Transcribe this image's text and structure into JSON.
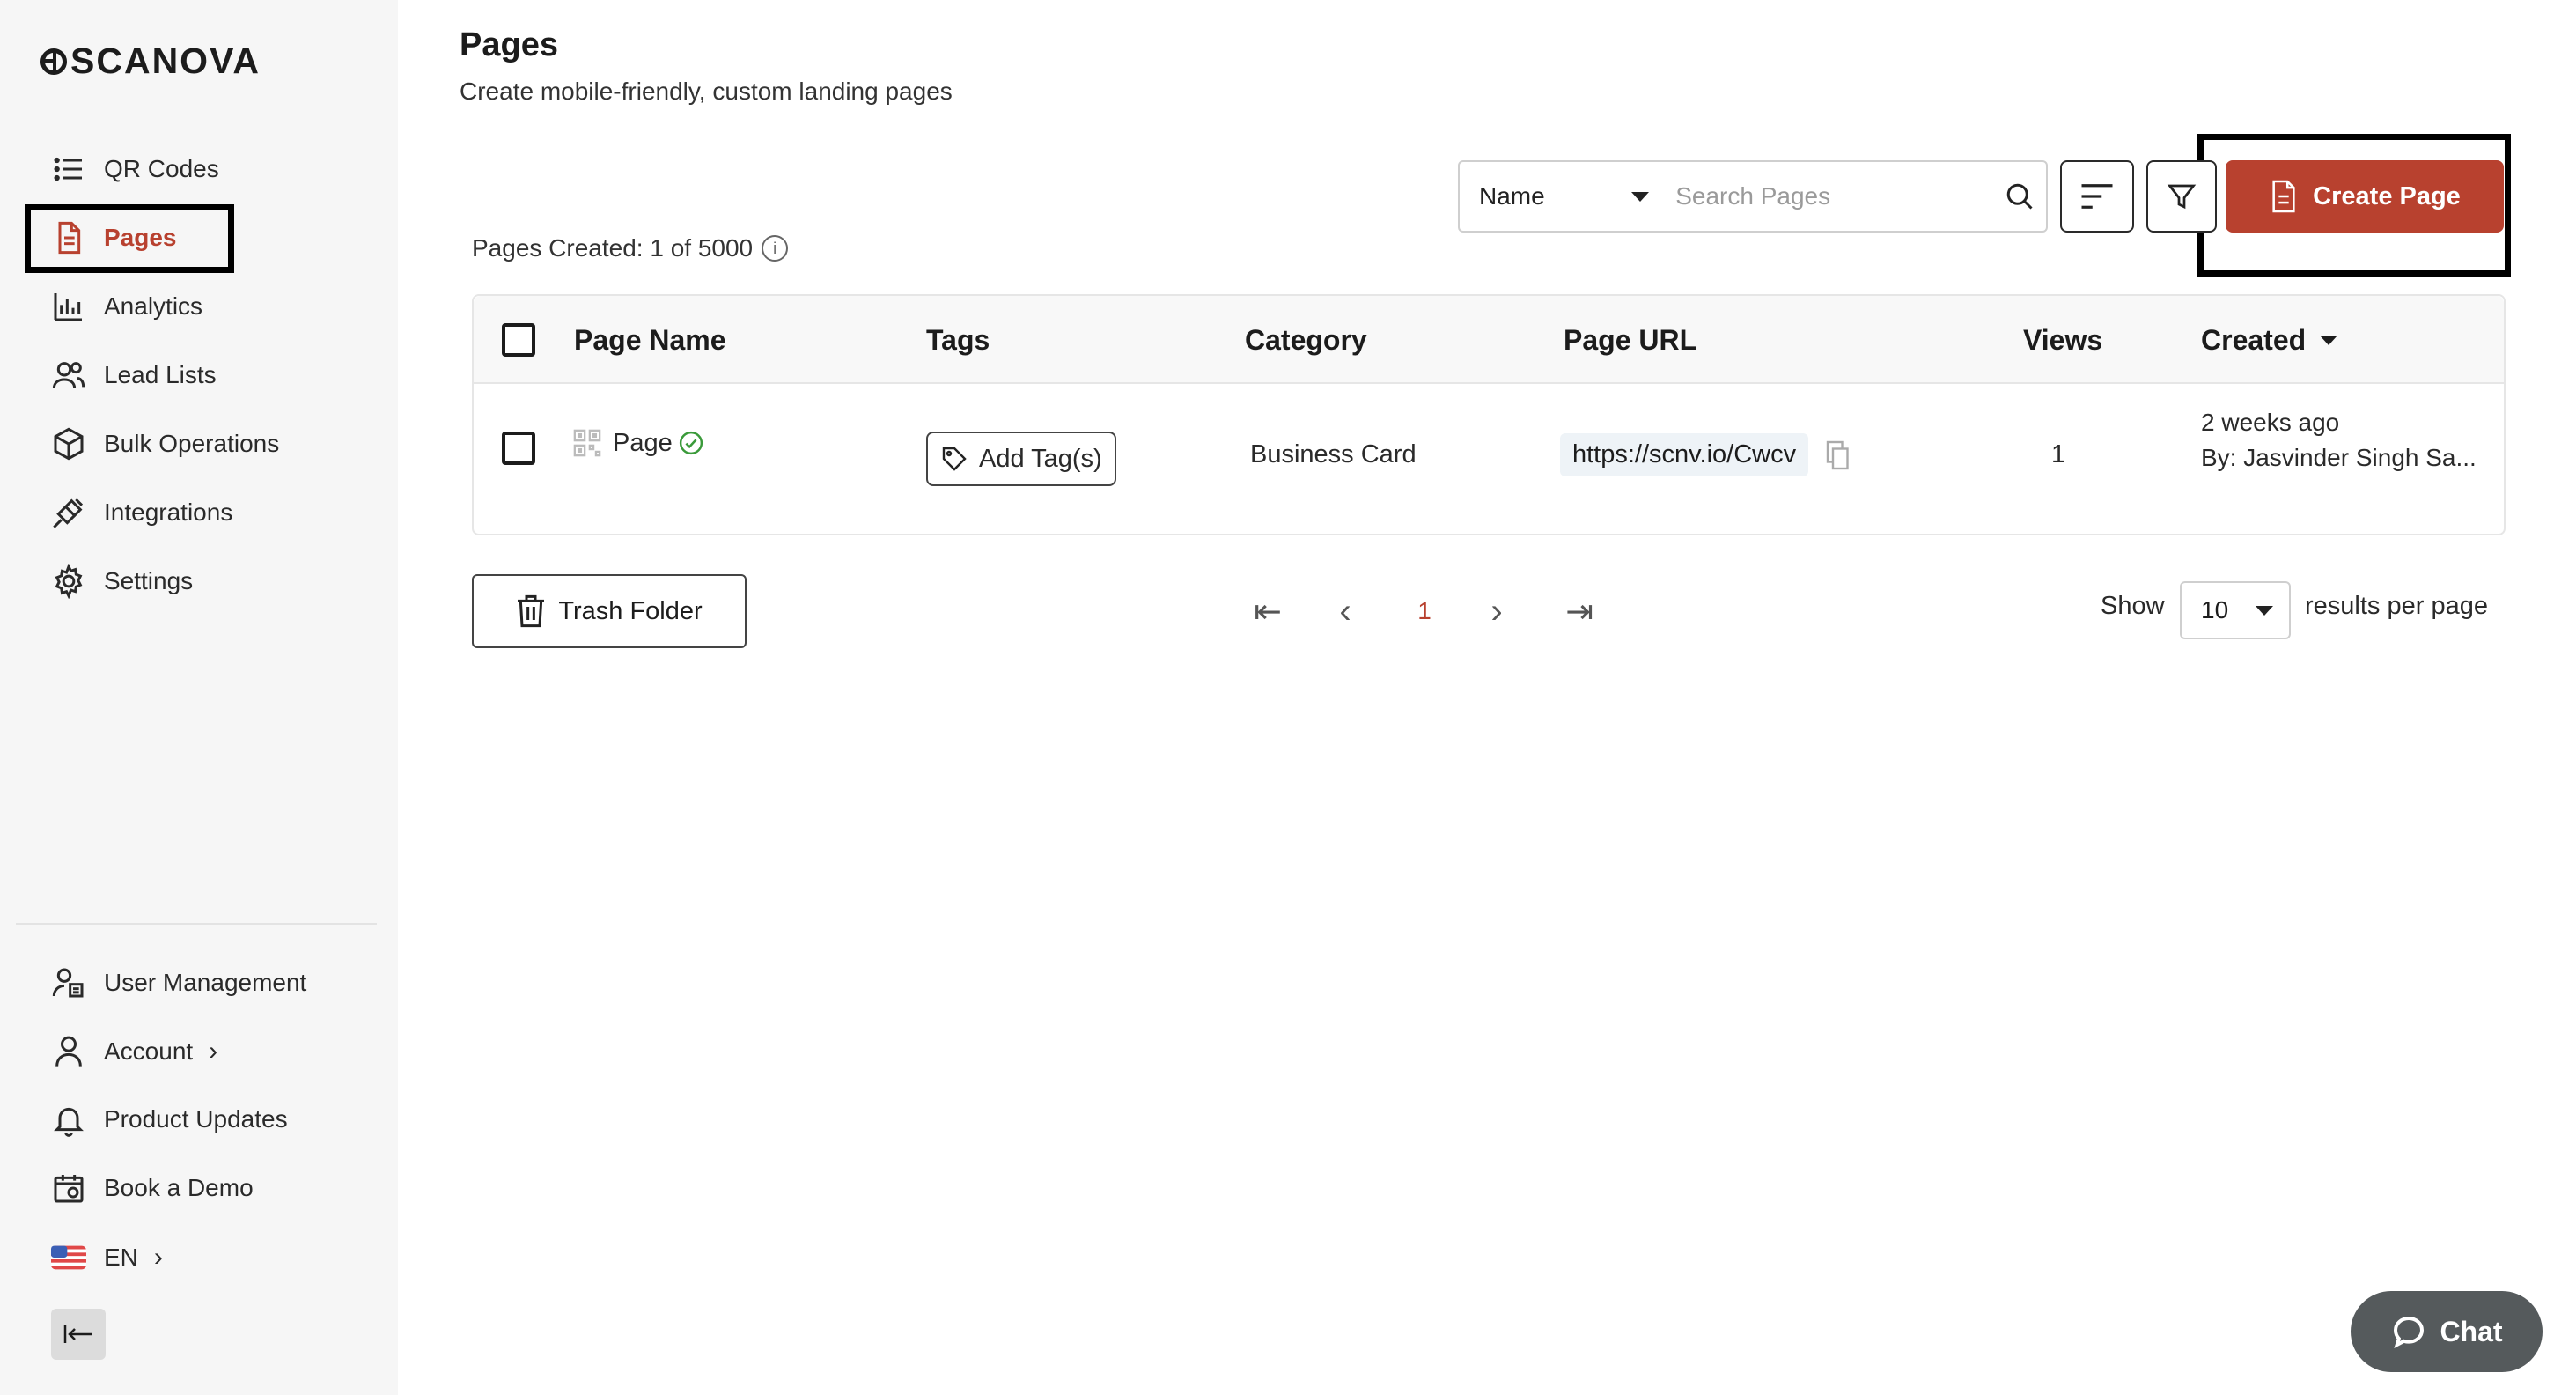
{
  "brand": {
    "name": "SCANOVA"
  },
  "sidebar": {
    "items": [
      {
        "label": "QR Codes",
        "icon": "list-icon"
      },
      {
        "label": "Pages",
        "icon": "page-icon",
        "active": true
      },
      {
        "label": "Analytics",
        "icon": "analytics-icon"
      },
      {
        "label": "Lead Lists",
        "icon": "users-icon"
      },
      {
        "label": "Bulk Operations",
        "icon": "cube-icon"
      },
      {
        "label": "Integrations",
        "icon": "plug-icon"
      },
      {
        "label": "Settings",
        "icon": "gear-icon"
      }
    ],
    "bottom_items": [
      {
        "label": "User Management",
        "icon": "user-management-icon"
      },
      {
        "label": "Account",
        "icon": "user-icon",
        "chevron": "›"
      },
      {
        "label": "Product Updates",
        "icon": "bell-icon"
      },
      {
        "label": "Book a Demo",
        "icon": "calendar-icon"
      },
      {
        "label": "EN",
        "icon": "us-flag-icon",
        "chevron": "›"
      }
    ]
  },
  "header": {
    "title": "Pages",
    "subtitle": "Create mobile-friendly, custom landing pages"
  },
  "toolbar": {
    "search_field": "Name",
    "search_placeholder": "Search Pages",
    "create_label": "Create Page"
  },
  "stats": {
    "pages_created": "Pages Created: 1 of 5000",
    "info": "i"
  },
  "table": {
    "columns": [
      "Page Name",
      "Tags",
      "Category",
      "Page URL",
      "Views",
      "Created"
    ],
    "rows": [
      {
        "name": "Page",
        "tags_action": "Add Tag(s)",
        "category": "Business Card",
        "url": "https://scnv.io/Cwcv",
        "views": "1",
        "created": "2 weeks ago",
        "created_by": "By: Jasvinder Singh Sa..."
      }
    ]
  },
  "footer": {
    "trash_label": "Trash Folder",
    "pagination": {
      "first": "⇤",
      "prev": "‹",
      "current": "1",
      "next": "›",
      "last": "⇥"
    },
    "show_label": "Show",
    "per_page": "10",
    "per_page_label": "results per page"
  },
  "chat": {
    "label": "Chat"
  },
  "colors": {
    "accent": "#b8412f",
    "sidebar_bg": "#f6f6f6",
    "success": "#3a9a3a"
  }
}
